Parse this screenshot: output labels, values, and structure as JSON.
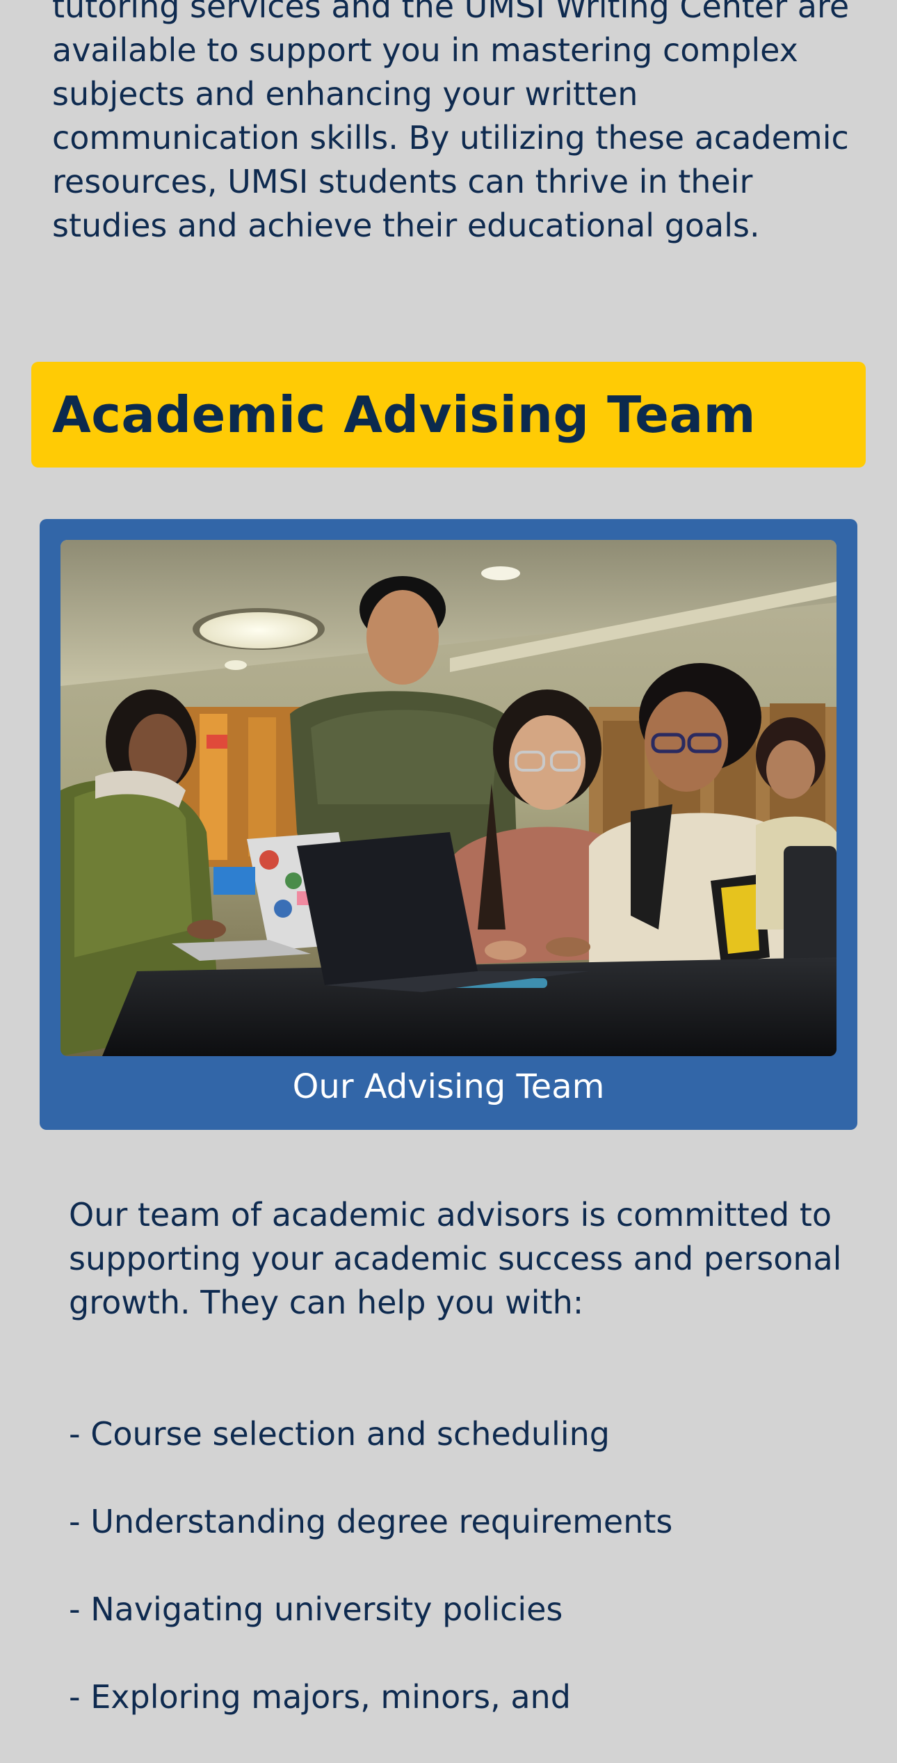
{
  "intro": {
    "text": "tutoring services and the UMSI Writing Center are available to support you in mastering complex subjects and enhancing your written communication skills. By utilizing these academic resources, UMSI students can thrive in their studies and achieve their educational goals."
  },
  "advising_section": {
    "heading": "Academic Advising Team",
    "photo": {
      "alt": "Students collaborating around laptops at a table",
      "caption": "Our Advising Team"
    },
    "description": "Our team of academic advisors is committed to supporting your academic success and personal growth. They can help you with:",
    "help_items": [
      "- Course selection and scheduling",
      "- Understanding degree requirements",
      "- Navigating university policies",
      "- Exploring majors, minors, and"
    ]
  },
  "colors": {
    "page_background": "#d3d3d3",
    "heading_bar": "#ffcb05",
    "photo_card": "#3266a8",
    "text_navy": "#0b2a4e"
  }
}
